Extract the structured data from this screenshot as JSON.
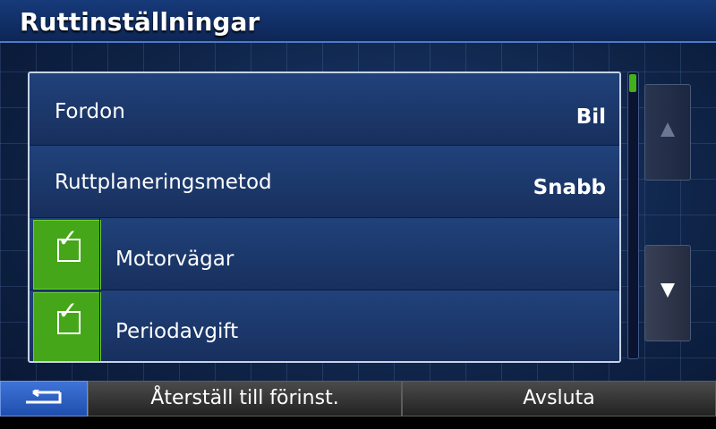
{
  "header": {
    "title": "Ruttinställningar"
  },
  "settings": {
    "rows": [
      {
        "label": "Fordon",
        "value": "Bil"
      },
      {
        "label": "Ruttplaneringsmetod",
        "value": "Snabb"
      },
      {
        "label": "Motorvägar",
        "checked": true,
        "check_icon": "checkbox-checked-icon"
      },
      {
        "label": "Periodavgift",
        "checked": true,
        "check_icon": "checkbox-checked-icon"
      }
    ]
  },
  "scroll": {
    "up_icon": "arrow-up-icon",
    "down_icon": "arrow-down-icon"
  },
  "footer": {
    "back_icon": "back-arrow-icon",
    "reset_label": "Återställ till förinst.",
    "exit_label": "Avsluta"
  },
  "colors": {
    "accent_green": "#45a619",
    "title_blue": "#173a7a",
    "back_blue": "#2f62c7"
  }
}
